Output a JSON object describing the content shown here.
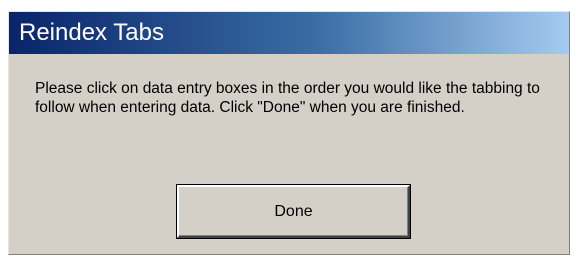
{
  "dialog": {
    "title": "Reindex Tabs",
    "message": "Please click on data entry boxes in the order you would like the tabbing to follow when entering data. Click \"Done\" when you are finished.",
    "done_label": "Done"
  }
}
